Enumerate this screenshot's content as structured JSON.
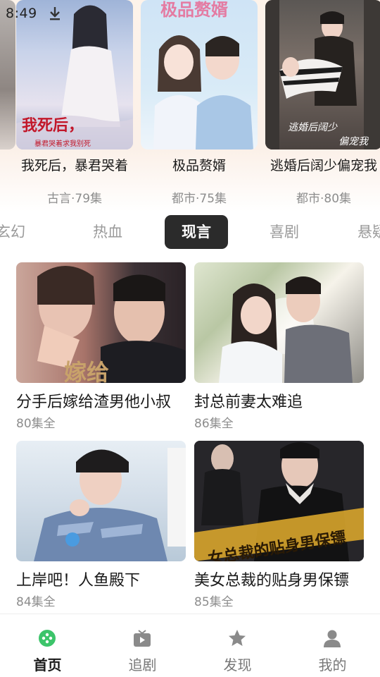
{
  "status_bar": {
    "time": "8:49",
    "download_icon": "download-arrow-icon"
  },
  "featured": [
    {
      "title": "我死后，暴君哭着",
      "genre": "古言",
      "episodes": "79集",
      "meta": "古言·79集",
      "cover_text": "我死后，",
      "cover_subtext": "暴君哭着求我别死"
    },
    {
      "title": "极品赘婿",
      "genre": "都市",
      "episodes": "75集",
      "meta": "都市·75集",
      "cover_text": "极品赘婿"
    },
    {
      "title": "逃婚后阔少偏宠我",
      "genre": "都市",
      "episodes": "80集",
      "meta": "都市·80集",
      "cover_text": "逃婚后阔少",
      "cover_subtext": "偏宠我"
    }
  ],
  "categories": [
    {
      "label": "玄幻",
      "active": false
    },
    {
      "label": "热血",
      "active": false
    },
    {
      "label": "现言",
      "active": true
    },
    {
      "label": "喜剧",
      "active": false
    },
    {
      "label": "悬疑",
      "active": false
    }
  ],
  "grid": [
    {
      "title": "分手后嫁给渣男他小叔",
      "meta": "80集全",
      "cover_text": "嫁给"
    },
    {
      "title": "封总前妻太难追",
      "meta": "86集全",
      "cover_text": ""
    },
    {
      "title": "上岸吧！人鱼殿下",
      "meta": "84集全",
      "cover_text": ""
    },
    {
      "title": "美女总裁的贴身男保镖",
      "meta": "85集全",
      "cover_text": "女总裁的贴身男保镖"
    }
  ],
  "bottom_nav": [
    {
      "label": "首页",
      "icon": "home-game-icon",
      "active": true
    },
    {
      "label": "追剧",
      "icon": "tv-play-icon",
      "active": false
    },
    {
      "label": "发现",
      "icon": "star-icon",
      "active": false
    },
    {
      "label": "我的",
      "icon": "person-icon",
      "active": false
    }
  ],
  "colors": {
    "accent_green": "#3cc46a",
    "active_tab_bg": "#2b2b2b",
    "text_primary": "#1a1a1a",
    "text_secondary": "#8d8d8d",
    "top_bg": "#fdf3ea"
  }
}
